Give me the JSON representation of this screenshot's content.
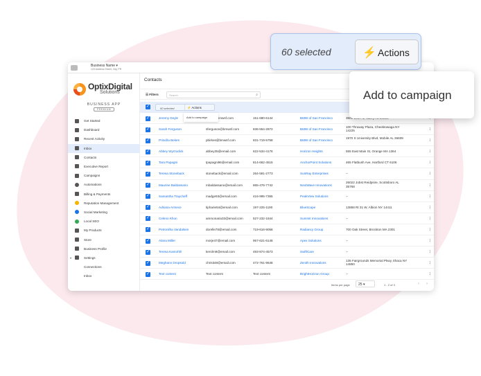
{
  "colors": {
    "accent": "#1a73e8",
    "selection_bg": "#e3ecfb",
    "backdrop": "#fbe9ee"
  },
  "topbar": {
    "business_name": "Business Name",
    "address": "123 Address Street, City, PR",
    "right_label": "ntacts"
  },
  "brand": {
    "name": "OptixDigital",
    "sub": "Solutions",
    "app": "BUSINESS APP",
    "tier": "PREMIUM"
  },
  "sidebar": {
    "items": [
      {
        "label": "Get Started",
        "icon": "bag-icon"
      },
      {
        "label": "Dashboard",
        "icon": "grid-icon"
      },
      {
        "label": "Recent Activity",
        "icon": "history-icon"
      },
      {
        "label": "Inbox",
        "icon": "inbox-icon",
        "active": true
      },
      {
        "label": "Contacts",
        "icon": "person-icon"
      },
      {
        "label": "Executive Report",
        "icon": "trend-icon"
      },
      {
        "label": "Campaigns",
        "icon": "mail-icon"
      },
      {
        "label": "Automations",
        "icon": "automation-icon"
      },
      {
        "label": "Billing & Payments",
        "icon": "billing-icon"
      },
      {
        "label": "Reputation Management",
        "icon": "star-icon"
      },
      {
        "label": "Social Marketing",
        "icon": "social-icon"
      },
      {
        "label": "Local SEO",
        "icon": "seo-icon"
      },
      {
        "label": "My Products",
        "icon": "apps-icon"
      },
      {
        "label": "Store",
        "icon": "store-icon"
      },
      {
        "label": "Business Profile",
        "icon": "profile-icon"
      },
      {
        "label": "Settings",
        "icon": "gear-icon",
        "expanded": true
      },
      {
        "label": "Connections",
        "icon": ""
      },
      {
        "label": "Inbox",
        "icon": ""
      }
    ]
  },
  "main": {
    "title": "Contacts",
    "filters_label": "Filters",
    "search_placeholder": "Search",
    "selected_text": "60 selected",
    "actions_label": "Actions",
    "menu_item": "Add to campaign",
    "rows": [
      {
        "name": "Jeremy Doyle",
        "email": "jdoyle@bmwsf.com",
        "phone": "151-680-6144",
        "company": "BMW of San Francisco",
        "address": "3501 20th Av, Valley AL 36854"
      },
      {
        "name": "Sarah Ferguson",
        "email": "sferguson@bmwsf.com",
        "phone": "836-554-2872",
        "company": "BMW of San Francisco",
        "address": "100 Thruway Plaza, Cheektowaga NY 14225"
      },
      {
        "name": "Priscilla Bekes",
        "email": "pbirkes@bmwsf.com",
        "phone": "831-719-5758",
        "company": "BMW of San Francisco",
        "address": "1970 S University Blvd, Mobile AL 36609"
      },
      {
        "name": "Abbey Wyrzodick",
        "email": "abbey35@email.com",
        "phone": "622-534-4176",
        "company": "Horizon Heights",
        "address": "555 East Main St, Orange MA 1364"
      },
      {
        "name": "Tara Papagni",
        "email": "tpapagni96@email.com",
        "phone": "814-662-4515",
        "company": "AnchorPoint Solutions",
        "address": "465 Flatbush Ave, Hartford CT 6106"
      },
      {
        "name": "Teresa Stoneback",
        "email": "stoneback@email.com",
        "phone": "264-581-2773",
        "company": "SunRay Enterprises",
        "address": "--"
      },
      {
        "name": "Maurine Baldassano",
        "email": "mbaldassano@email.com",
        "phone": "865-476-7742",
        "company": "NextWave Innovations",
        "address": "26022 Jobst Reidpsire, Scottsboro AL 35768"
      },
      {
        "name": "Samantha Traycheff",
        "email": "madge93@email.com",
        "phone": "416-995-7365",
        "company": "PeakView Solutions",
        "address": "--"
      },
      {
        "name": "Adriana Armece",
        "email": "tipharie54@email.com",
        "phone": "197-225-1190",
        "company": "BlueScape",
        "address": "13858 Rt 31 W, Albion NY 14411"
      },
      {
        "name": "Celeno Khon",
        "email": "ammonaria33@email.com",
        "phone": "527-232-1844",
        "company": "Summit Innovations",
        "address": "--"
      },
      {
        "name": "Petronilha Vandalsen",
        "email": "dorelle78@email.com",
        "phone": "719-616-9058",
        "company": "Radiancy Group",
        "address": "700 Oak Street, Brockton MA 2301"
      },
      {
        "name": "Alana Miller",
        "email": "morje47@email.com",
        "phone": "957-621-6148",
        "company": "Apex Solutions",
        "address": "--"
      },
      {
        "name": "Teresa Kamohlil",
        "email": "kerolm9@email.com",
        "phone": "493-874-4573",
        "company": "SwiftCare",
        "address": "--"
      },
      {
        "name": "Meghann Dropsold",
        "email": "chrisit48@email.com",
        "phone": "472-761-9648",
        "company": "Zenith Innovations",
        "address": "135 Fairgrounds Memorial Pkwy, Ithaca NY 14850"
      },
      {
        "name": "Text content",
        "email": "Text content",
        "phone": "Text content",
        "company": "BrightHorizon Group",
        "address": "--"
      }
    ],
    "pagination": {
      "per_page_label": "Items per page",
      "per_page": "25",
      "range": "1 - 2 of 3"
    }
  },
  "callout": {
    "selected_text": "60 selected",
    "actions_label": "Actions",
    "menu_item": "Add to campaign"
  }
}
